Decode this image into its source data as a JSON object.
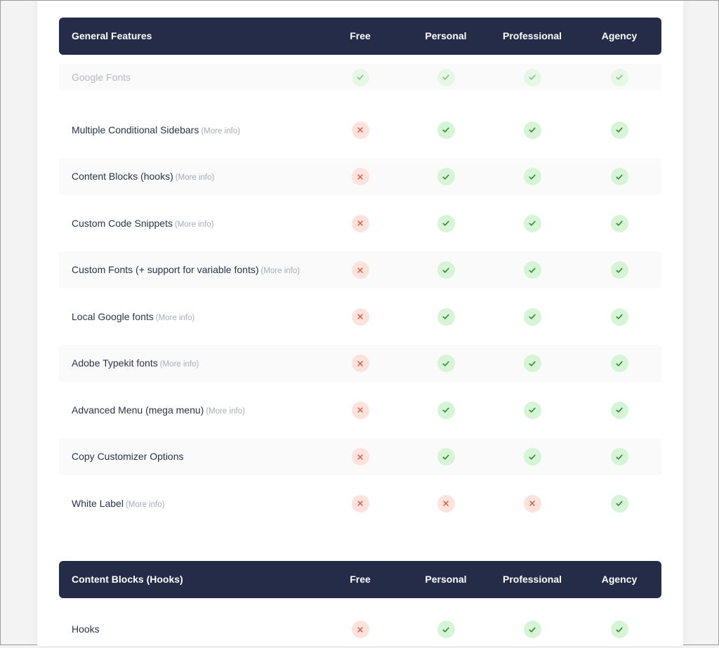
{
  "tables": [
    {
      "header": {
        "title": "General Features",
        "columns": [
          "Free",
          "Personal",
          "Professional",
          "Agency"
        ]
      },
      "rows": [
        {
          "label": "Google Fonts",
          "more": "",
          "values": [
            true,
            true,
            true,
            true
          ]
        },
        {
          "label": "Multiple Conditional Sidebars",
          "more": "(More info)",
          "values": [
            false,
            true,
            true,
            true
          ]
        },
        {
          "label": "Content Blocks (hooks)",
          "more": "(More info)",
          "values": [
            false,
            true,
            true,
            true
          ]
        },
        {
          "label": "Custom Code Snippets",
          "more": "(More info)",
          "values": [
            false,
            true,
            true,
            true
          ]
        },
        {
          "label": "Custom Fonts (+ support for variable fonts)",
          "more": "(More info)",
          "values": [
            false,
            true,
            true,
            true
          ]
        },
        {
          "label": "Local Google fonts",
          "more": "(More info)",
          "values": [
            false,
            true,
            true,
            true
          ]
        },
        {
          "label": "Adobe Typekit fonts",
          "more": "(More info)",
          "values": [
            false,
            true,
            true,
            true
          ]
        },
        {
          "label": "Advanced Menu (mega menu)",
          "more": "(More info)",
          "values": [
            false,
            true,
            true,
            true
          ]
        },
        {
          "label": "Copy Customizer Options",
          "more": "",
          "values": [
            false,
            true,
            true,
            true
          ]
        },
        {
          "label": "White Label",
          "more": "(More info)",
          "values": [
            false,
            false,
            false,
            true
          ]
        }
      ]
    },
    {
      "header": {
        "title": "Content Blocks (Hooks)",
        "columns": [
          "Free",
          "Personal",
          "Professional",
          "Agency"
        ]
      },
      "rows": [
        {
          "label": "Hooks",
          "more": "",
          "values": [
            false,
            true,
            true,
            true
          ]
        }
      ]
    }
  ],
  "icons": {
    "yes": "check-icon",
    "no": "cross-icon"
  },
  "colors": {
    "header_bg": "#252c47",
    "yes_bg": "#d6f5d6",
    "yes_fg": "#2f8a2f",
    "no_bg": "#fde3dc",
    "no_fg": "#e0553a"
  }
}
